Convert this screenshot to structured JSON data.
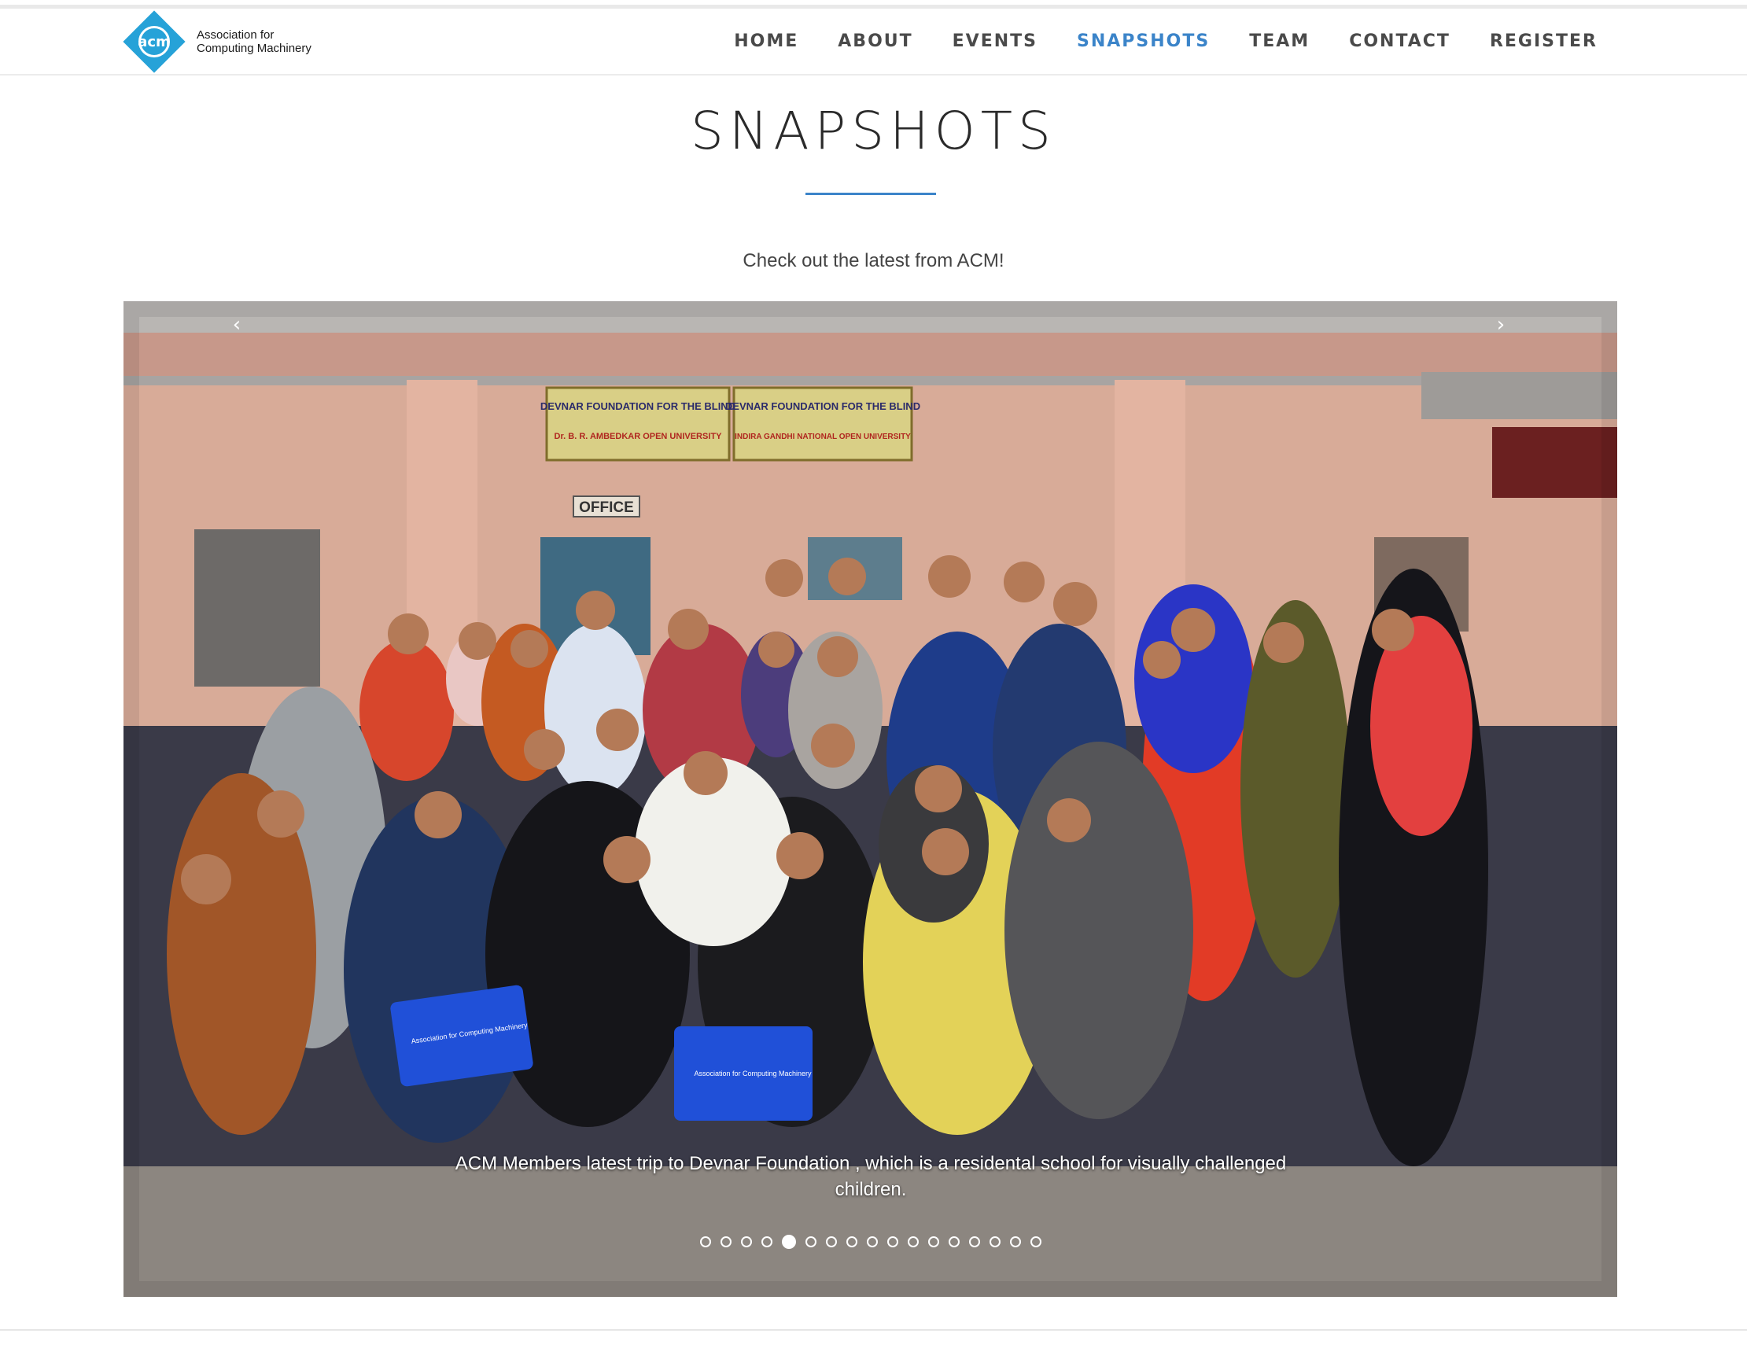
{
  "logo": {
    "line1": "Association for",
    "line2": "Computing Machinery",
    "mark": "acm"
  },
  "nav": {
    "items": [
      {
        "label": "HOME"
      },
      {
        "label": "ABOUT"
      },
      {
        "label": "EVENTS"
      },
      {
        "label": "SNAPSHOTS",
        "active": true
      },
      {
        "label": "TEAM"
      },
      {
        "label": "CONTACT"
      },
      {
        "label": "REGISTER"
      }
    ]
  },
  "page": {
    "title": "SNAPSHOTS",
    "subtitle": "Check out the latest from ACM!"
  },
  "carousel": {
    "prev_icon": "chevron-left-icon",
    "next_icon": "chevron-right-icon",
    "caption": "ACM Members latest trip to Devnar Foundation , which is a residental school for visually challenged children.",
    "photo_signs": {
      "sign1_title": "DEVNAR FOUNDATION FOR THE BLIND",
      "sign1_sub": "Dr. B. R. AMBEDKAR OPEN UNIVERSITY",
      "sign2_title": "DEVNAR FOUNDATION FOR THE BLIND",
      "sign2_sub": "INDIRA GANDHI NATIONAL OPEN UNIVERSITY",
      "office": "OFFICE",
      "bag_text": "Association for Computing Machinery"
    },
    "slide_count": 17,
    "active_index": 4
  },
  "colors": {
    "accent": "#3b84c9",
    "logo_blue": "#26a2d8",
    "nav_text": "#4a4a4a"
  }
}
